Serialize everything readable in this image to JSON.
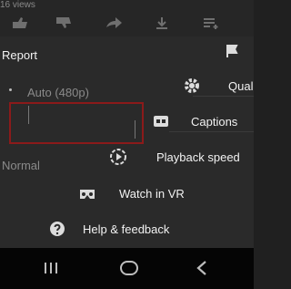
{
  "video": {
    "views": "16 views"
  },
  "menu": {
    "report": "Report",
    "quality": {
      "label": "Qual",
      "value": "Auto (480p)"
    },
    "captions": {
      "label": "Captions"
    },
    "speed": {
      "label": "Playback speed",
      "value": "Normal"
    },
    "watch_vr": "Watch in VR",
    "help": "Help & feedback"
  },
  "colors": {
    "highlight": "#8b1a1a",
    "menu_bg": "#2a2a2a",
    "nav_bg": "#050505"
  },
  "icons": [
    "flag-icon",
    "gear-icon",
    "cc-icon",
    "speed-icon",
    "vr-headset-icon",
    "help-icon",
    "recents-icon",
    "home-icon",
    "back-icon"
  ]
}
